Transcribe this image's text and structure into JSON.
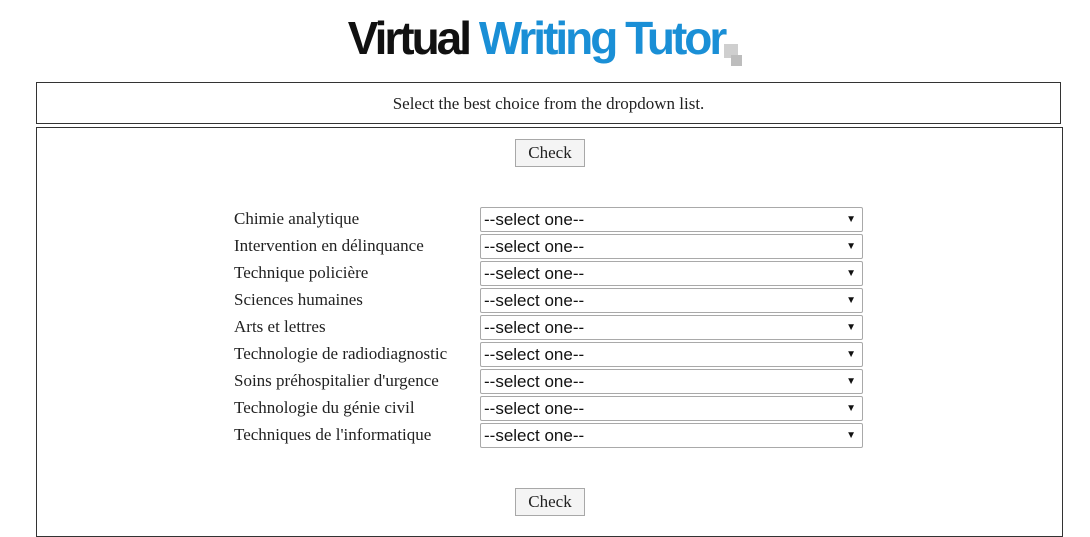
{
  "logo": {
    "word1": "Virtual",
    "word2": "Writing Tutor",
    "colors": {
      "dark": "#111111",
      "accent": "#1a8fd6"
    }
  },
  "instructions": "Select the best choice from the dropdown list.",
  "check_label": "Check",
  "rows": [
    {
      "label": "Chimie analytique",
      "selected": "--select one--"
    },
    {
      "label": "Intervention en délinquance",
      "selected": "--select one--"
    },
    {
      "label": "Technique policière",
      "selected": "--select one--"
    },
    {
      "label": "Sciences humaines",
      "selected": "--select one--"
    },
    {
      "label": "Arts et lettres",
      "selected": "--select one--"
    },
    {
      "label": "Technologie de radiodiagnostic",
      "selected": "--select one--"
    },
    {
      "label": "Soins préhospitalier d'urgence",
      "selected": "--select one--"
    },
    {
      "label": "Technologie du génie civil",
      "selected": "--select one--"
    },
    {
      "label": "Techniques de l'informatique",
      "selected": "--select one--"
    }
  ],
  "icons": {
    "dropdown": "chevron-down-icon"
  }
}
